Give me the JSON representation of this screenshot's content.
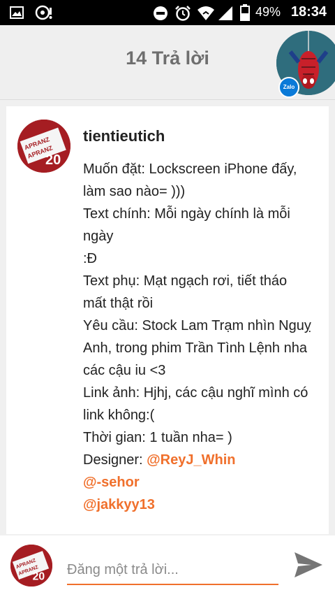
{
  "status_bar": {
    "battery": "49%",
    "time": "18:34",
    "icons": [
      "image-icon",
      "headset-icon",
      "minus-circle-icon",
      "alarm-icon",
      "wifi-icon",
      "signal-icon",
      "battery-icon"
    ]
  },
  "header": {
    "title": "14 Trả lời",
    "chathead_badge": "Zalo"
  },
  "post": {
    "username": "tientieutich",
    "lines": [
      "Muốn đặt: Lockscreen iPhone đấy,",
      "làm sao nào= )))",
      "Text chính: Mỗi ngày chính là mỗi",
      "ngày",
      ":Đ",
      "Text phụ: Mạt ngạch rơi, tiết tháo",
      "mất thật rồi",
      "Yêu cầu: Stock Lam Trạm nhìn Nguỵ",
      "Anh, trong phim Trần Tình Lệnh nha",
      "các cậu iu <3",
      "Link ảnh: Hjhj, các cậu nghĩ mình có",
      "link không:(",
      "Thời gian: 1 tuần nha= )"
    ],
    "designer_label": "Designer: ",
    "mentions": [
      "@ReyJ_Whin",
      "@-sehor",
      "@jakkyy13"
    ],
    "avatar_badge": "20",
    "avatar_text": "APRANZ"
  },
  "reply": {
    "placeholder": "Đăng một trả lời..."
  },
  "colors": {
    "accent": "#f0702c",
    "avatar_bg": "#a51d22",
    "header_bg": "#efefef"
  }
}
